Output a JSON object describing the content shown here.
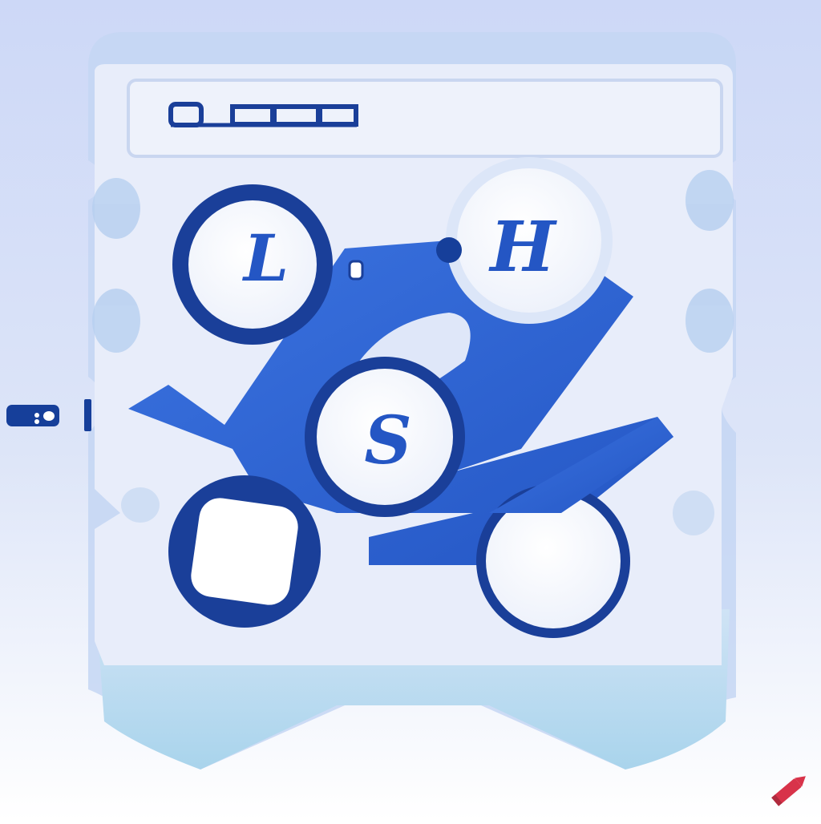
{
  "illustration": {
    "toolbar": {
      "segments": 4
    },
    "buttons": [
      {
        "id": "top-left",
        "letter": "L"
      },
      {
        "id": "top-right",
        "letter": "H"
      },
      {
        "id": "center",
        "letter": "S"
      },
      {
        "id": "bottom-left",
        "letter": ""
      },
      {
        "id": "bottom-right",
        "letter": ""
      }
    ],
    "side_label": "",
    "colors": {
      "background_top": "#cdd8f7",
      "background_bottom": "#ffffff",
      "panel": "#e6ecfa",
      "panel_edge": "#b9cdf0",
      "accent": "#2b62d4",
      "accent_dark": "#163f9a",
      "ring": "#1a3f99",
      "button_face": "#ffffff",
      "tray": "#a9d4ec",
      "watermark": "#d8334a"
    },
    "icons": [
      "pencil-icon"
    ]
  }
}
